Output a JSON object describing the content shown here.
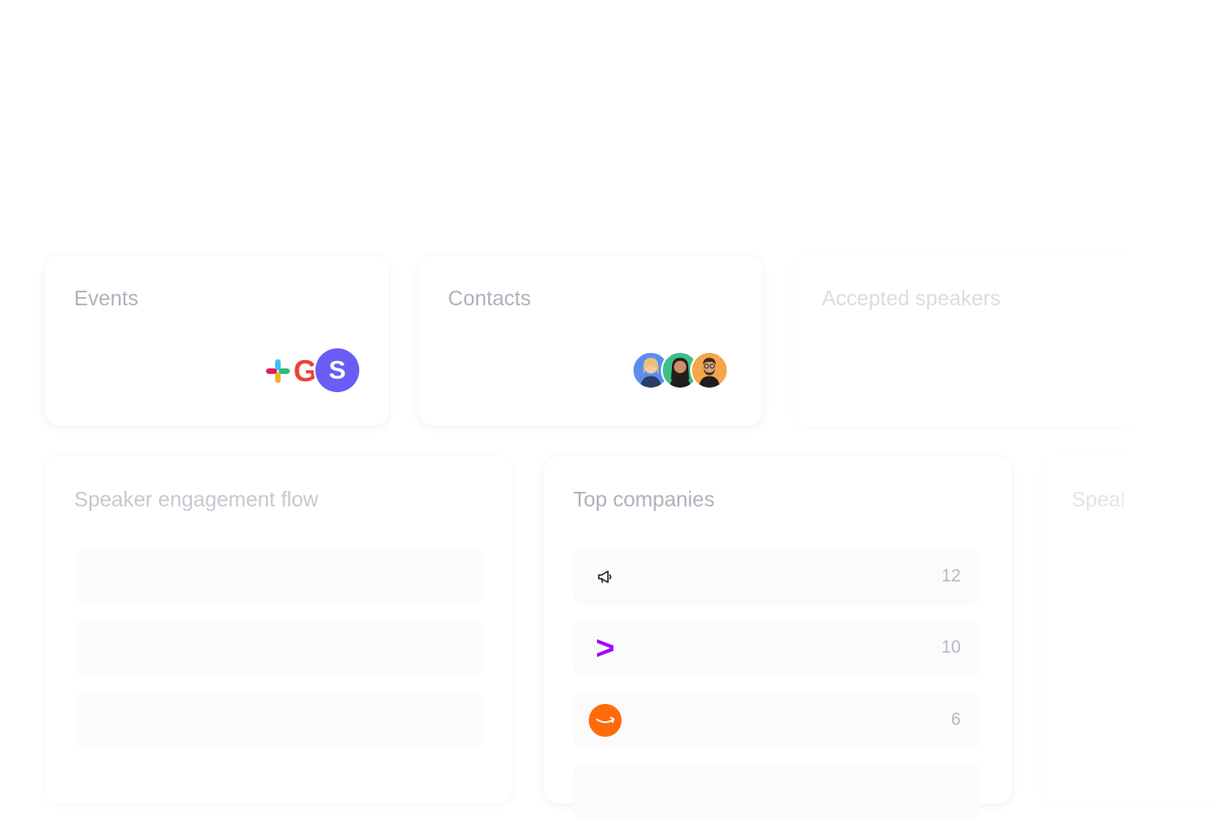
{
  "cards": {
    "events": {
      "title": "Events"
    },
    "contacts": {
      "title": "Contacts"
    },
    "accepted_speakers": {
      "title": "Accepted speakers"
    },
    "speaker_engagement_flow": {
      "title": "Speaker engagement flow"
    },
    "top_companies": {
      "title": "Top companies",
      "rows": [
        {
          "logo": "megaphone-icon",
          "count": "12"
        },
        {
          "logo": "accenture-logo",
          "count": "10"
        },
        {
          "logo": "amazon-logo",
          "count": "6"
        }
      ]
    },
    "speakers": {
      "title": "Speal"
    }
  },
  "integrations": {
    "google_glyph": "G",
    "brand_glyph": "S"
  },
  "colors": {
    "brand_purple": "#6a5cf5",
    "accenture_purple": "#a100ff",
    "amazon_orange": "#ff6b0a",
    "title_gray": "#aeb2bb"
  }
}
